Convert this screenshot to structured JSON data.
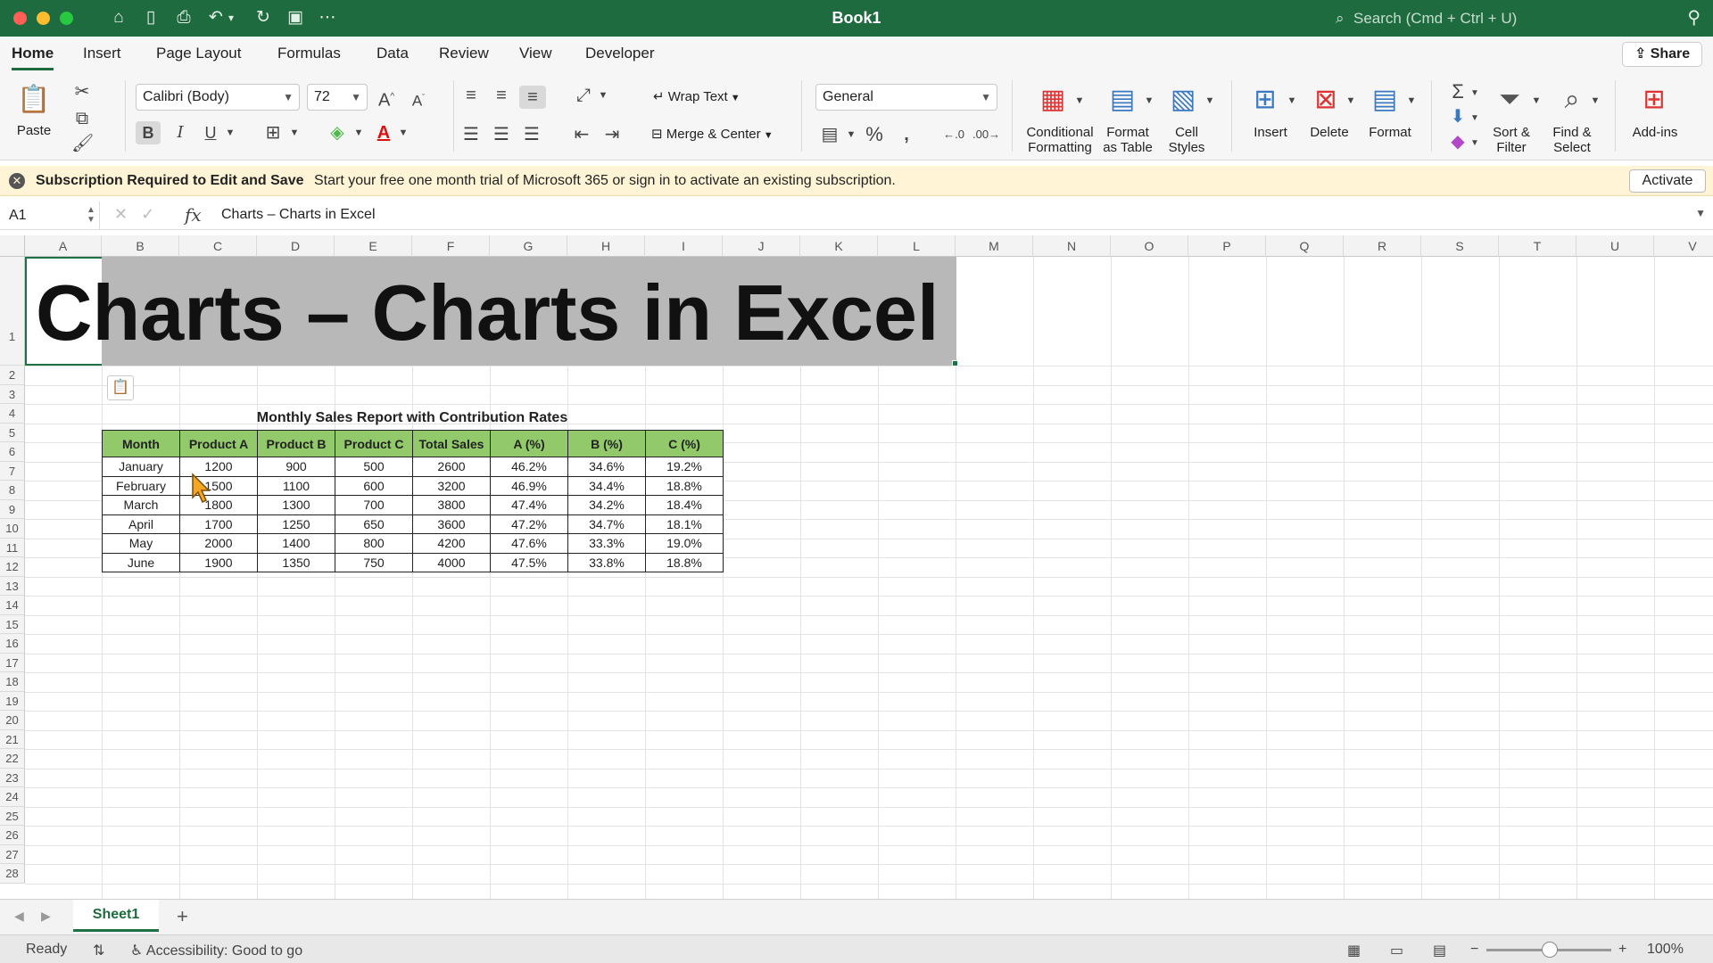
{
  "window": {
    "title": "Book1",
    "search_placeholder": "Search (Cmd + Ctrl + U)"
  },
  "tabs": [
    "Home",
    "Insert",
    "Page Layout",
    "Formulas",
    "Data",
    "Review",
    "View",
    "Developer"
  ],
  "active_tab": "Home",
  "share_label": "Share",
  "ribbon": {
    "paste_label": "Paste",
    "font_name": "Calibri (Body)",
    "font_size": "72",
    "wrap_text": "Wrap Text",
    "merge_center": "Merge & Center",
    "number_format": "General",
    "conditional_formatting": [
      "Conditional",
      "Formatting"
    ],
    "format_as_table": [
      "Format",
      "as Table"
    ],
    "cell_styles": [
      "Cell",
      "Styles"
    ],
    "insert": "Insert",
    "delete": "Delete",
    "format": "Format",
    "sort_filter": [
      "Sort &",
      "Filter"
    ],
    "find_select": [
      "Find &",
      "Select"
    ],
    "add_ins": "Add-ins"
  },
  "message_bar": {
    "bold": "Subscription Required to Edit and Save",
    "text": "Start your free one month trial of Microsoft 365 or sign in to activate an existing subscription.",
    "button": "Activate"
  },
  "formula_bar": {
    "name_box": "A1",
    "content": "Charts – Charts in Excel"
  },
  "columns": [
    "A",
    "B",
    "C",
    "D",
    "E",
    "F",
    "G",
    "H",
    "I",
    "J",
    "K",
    "L",
    "M",
    "N",
    "O",
    "P",
    "Q",
    "R",
    "S",
    "T",
    "U",
    "V"
  ],
  "rows": [
    "1",
    "2",
    "3",
    "4",
    "5",
    "6",
    "7",
    "8",
    "9",
    "10",
    "11",
    "12",
    "13",
    "14",
    "15",
    "16",
    "17",
    "18",
    "19",
    "20",
    "21",
    "22",
    "23",
    "24",
    "25",
    "26",
    "27",
    "28"
  ],
  "sheet": {
    "title": "Charts – Charts in Excel",
    "report_title": "Monthly Sales Report with Contribution Rates",
    "headers": [
      "Month",
      "Product A",
      "Product B",
      "Product C",
      "Total Sales",
      "A (%)",
      "B (%)",
      "C (%)"
    ],
    "data": [
      [
        "January",
        "1200",
        "900",
        "500",
        "2600",
        "46.2%",
        "34.6%",
        "19.2%"
      ],
      [
        "February",
        "1500",
        "1100",
        "600",
        "3200",
        "46.9%",
        "34.4%",
        "18.8%"
      ],
      [
        "March",
        "1800",
        "1300",
        "700",
        "3800",
        "47.4%",
        "34.2%",
        "18.4%"
      ],
      [
        "April",
        "1700",
        "1250",
        "650",
        "3600",
        "47.2%",
        "34.7%",
        "18.1%"
      ],
      [
        "May",
        "2000",
        "1400",
        "800",
        "4200",
        "47.6%",
        "33.3%",
        "19.0%"
      ],
      [
        "June",
        "1900",
        "1350",
        "750",
        "4000",
        "47.5%",
        "33.8%",
        "18.8%"
      ]
    ]
  },
  "sheet_tabs": {
    "name": "Sheet1",
    "add": "+"
  },
  "status": {
    "ready": "Ready",
    "accessibility": "Accessibility: Good to go",
    "zoom": "100%"
  },
  "colors": {
    "brand_green": "#1e6b3f",
    "header_fill": "#92c96a"
  }
}
